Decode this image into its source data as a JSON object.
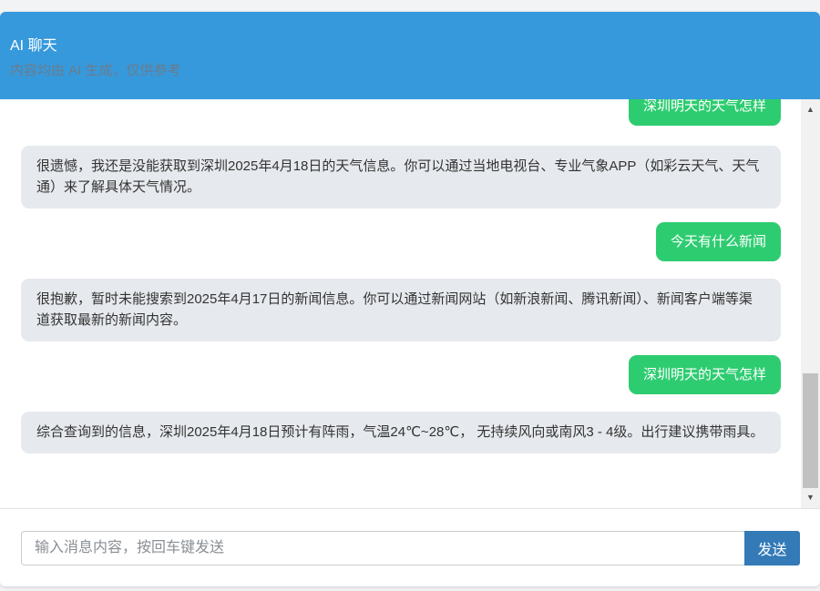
{
  "header": {
    "title": "AI 聊天",
    "subtitle": "内容均由 AI 生成，仅供参考"
  },
  "messages": [
    {
      "role": "user",
      "text": "深圳明天的天气怎样"
    },
    {
      "role": "ai",
      "text": "很遗憾，我还是没能获取到深圳2025年4月18日的天气信息。你可以通过当地电视台、专业气象APP（如彩云天气、天气通）来了解具体天气情况。"
    },
    {
      "role": "user",
      "text": "今天有什么新闻"
    },
    {
      "role": "ai",
      "text": "很抱歉，暂时未能搜索到2025年4月17日的新闻信息。你可以通过新闻网站（如新浪新闻、腾讯新闻）、新闻客户端等渠道获取最新的新闻内容。"
    },
    {
      "role": "user",
      "text": "深圳明天的天气怎样"
    },
    {
      "role": "ai",
      "text": "综合查询到的信息，深圳2025年4月18日预计有阵雨，气温24℃~28℃， 无持续风向或南风3 - 4级。出行建议携带雨具。"
    }
  ],
  "input": {
    "placeholder": "输入消息内容，按回车键发送",
    "value": ""
  },
  "send_button": {
    "label": "发送"
  },
  "scrollbar": {
    "up_icon": "▲",
    "down_icon": "▼"
  },
  "colors": {
    "header": "#3699dc",
    "user_bubble": "#2ecc71",
    "ai_bubble": "#e6e9ed",
    "send_button": "#337ab7"
  }
}
